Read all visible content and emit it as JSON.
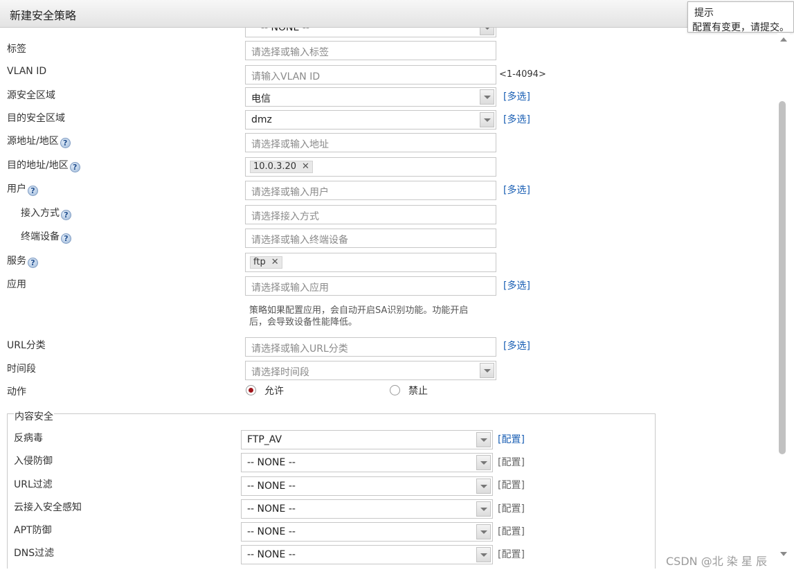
{
  "window": {
    "title": "新建安全策略"
  },
  "tooltip": {
    "title": "提示",
    "message": "配置有变更，请提交。"
  },
  "top_partial_select": {
    "value": "-- NONE --"
  },
  "form": {
    "tag": {
      "label": "标签",
      "placeholder": "请选择或输入标签"
    },
    "vlan": {
      "label": "VLAN ID",
      "placeholder": "请输入VLAN ID",
      "range": "<1-4094>"
    },
    "src_zone": {
      "label": "源安全区域",
      "value": "电信",
      "multi": "[多选]"
    },
    "dst_zone": {
      "label": "目的安全区域",
      "value": "dmz",
      "multi": "[多选]"
    },
    "src_addr": {
      "label": "源地址/地区",
      "placeholder": "请选择或输入地址"
    },
    "dst_addr": {
      "label": "目的地址/地区",
      "tag": "10.0.3.20",
      "remove": "✕"
    },
    "user": {
      "label": "用户",
      "placeholder": "请选择或输入用户",
      "multi": "[多选]"
    },
    "access": {
      "label": "接入方式",
      "placeholder": "请选择接入方式"
    },
    "terminal": {
      "label": "终端设备",
      "placeholder": "请选择或输入终端设备"
    },
    "service": {
      "label": "服务",
      "tag": "ftp",
      "remove": "✕"
    },
    "app": {
      "label": "应用",
      "placeholder": "请选择或输入应用",
      "multi": "[多选]",
      "hint_line1": "策略如果配置应用，会自动开启SA识别功能。功能开启",
      "hint_line2": "后，会导致设备性能降低。"
    },
    "url_cat": {
      "label": "URL分类",
      "placeholder": "请选择或输入URL分类",
      "multi": "[多选]"
    },
    "schedule": {
      "label": "时间段",
      "placeholder": "请选择时间段"
    },
    "action": {
      "label": "动作",
      "allow": "允许",
      "deny": "禁止",
      "selected": "允许"
    }
  },
  "content_security": {
    "legend": "内容安全",
    "config_label": "[配置]",
    "rows": [
      {
        "label": "反病毒",
        "value": "FTP_AV"
      },
      {
        "label": "入侵防御",
        "value": "-- NONE --"
      },
      {
        "label": "URL过滤",
        "value": "-- NONE --"
      },
      {
        "label": "云接入安全感知",
        "value": "-- NONE --"
      },
      {
        "label": "APT防御",
        "value": "-- NONE --"
      },
      {
        "label": "DNS过滤",
        "value": "-- NONE --"
      }
    ]
  },
  "watermark": "CSDN @北 染 星 辰",
  "colors": {
    "link": "#1a5fb4",
    "radio_selected": "#a0161c"
  }
}
